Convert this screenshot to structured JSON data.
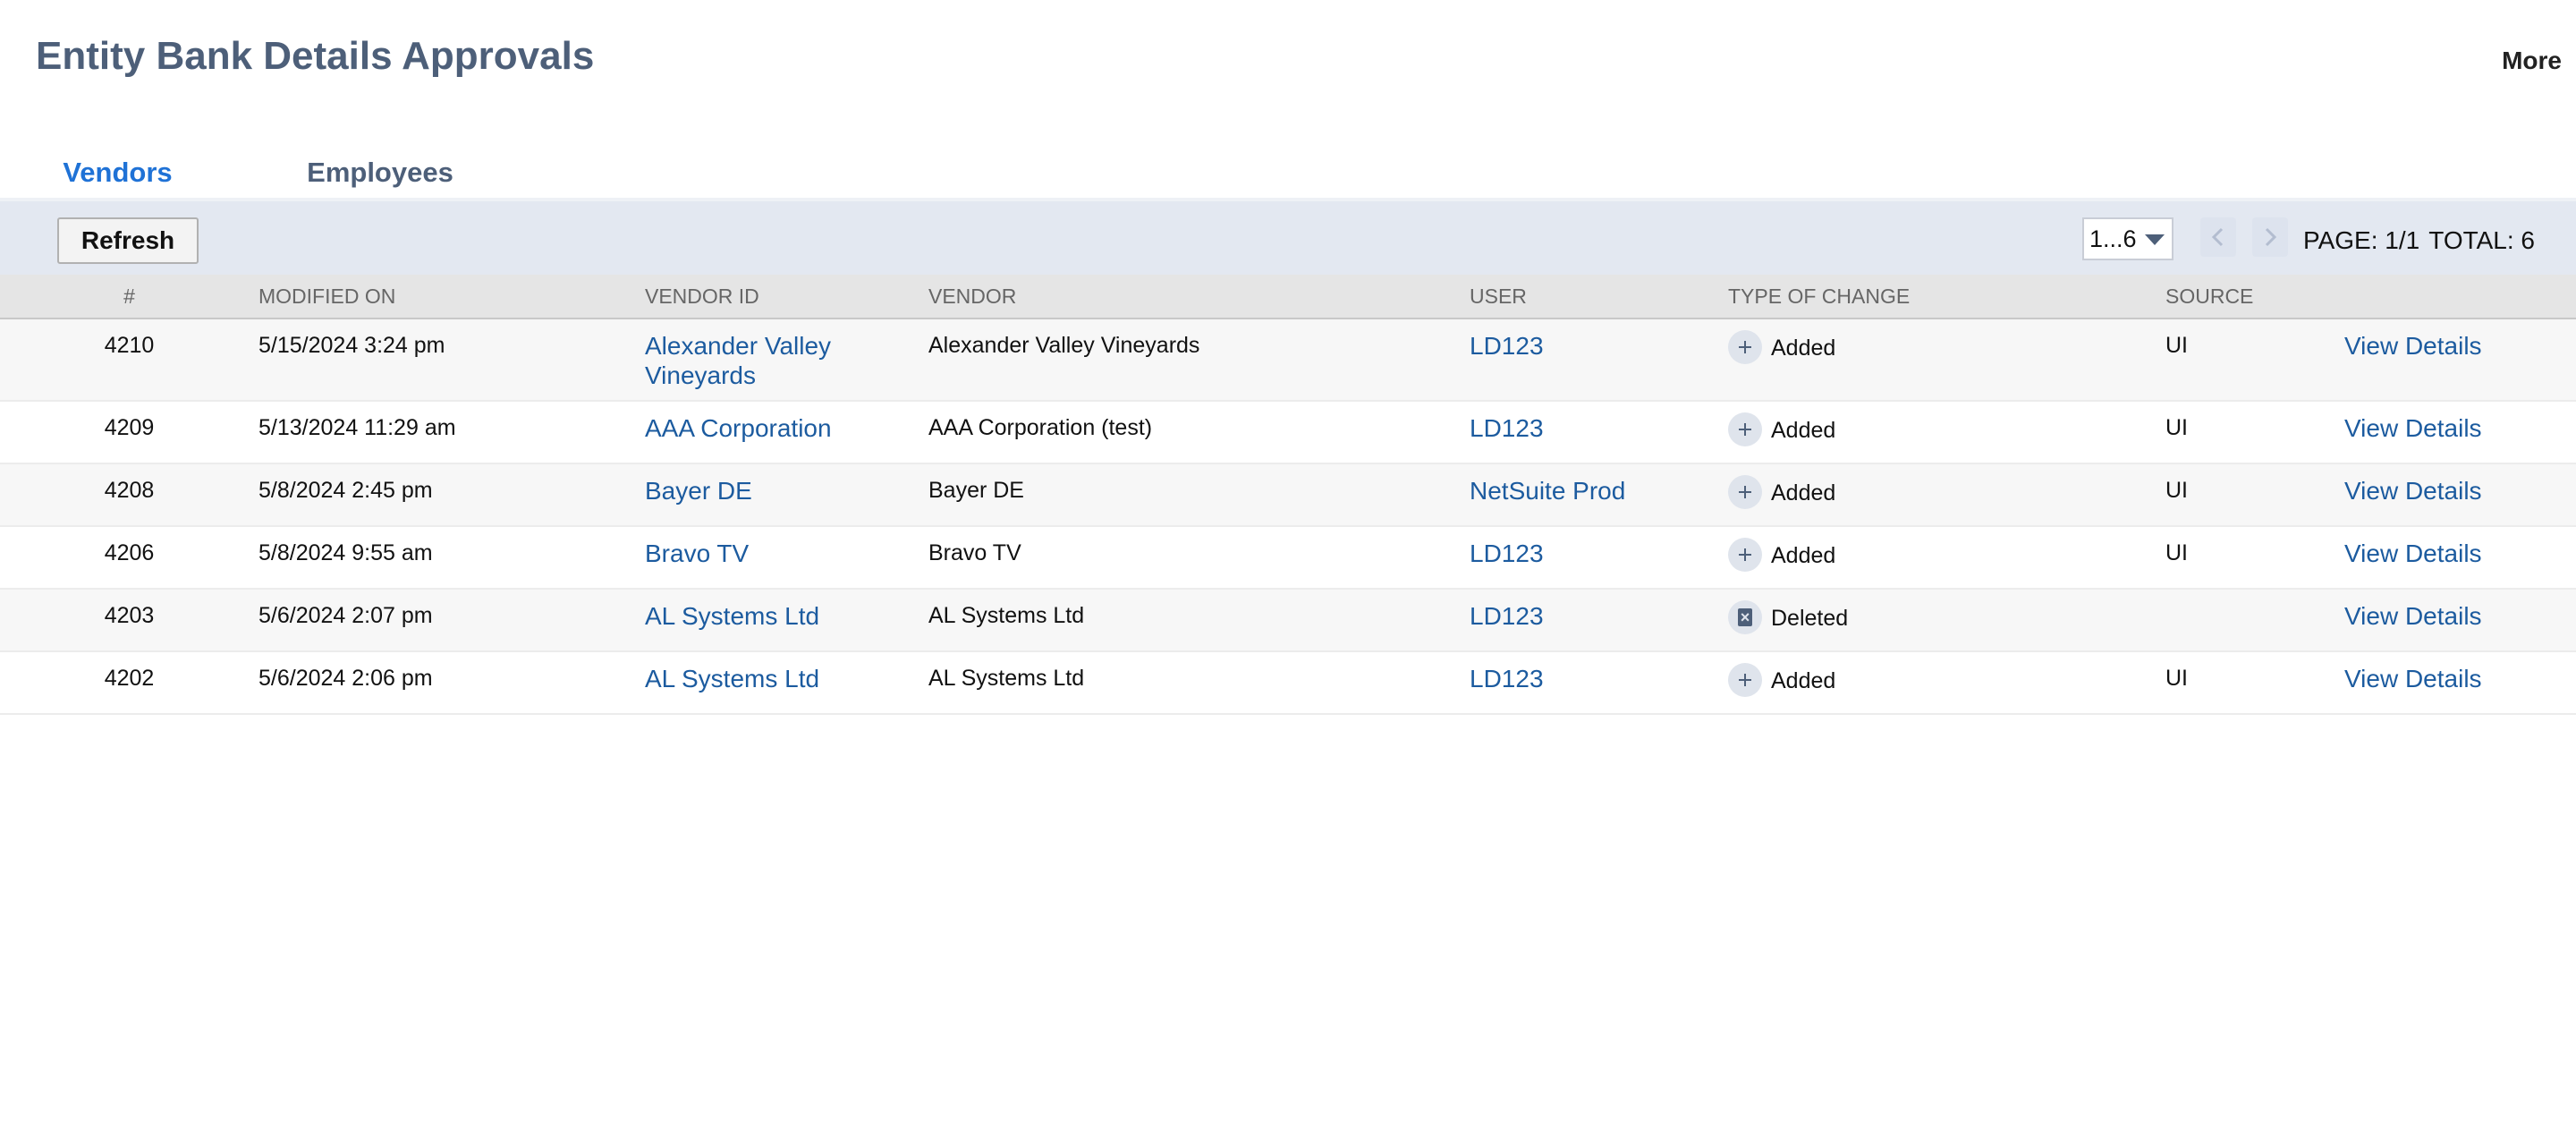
{
  "page": {
    "title": "Entity Bank Details Approvals",
    "more_label": "More"
  },
  "tabs": [
    {
      "label": "Vendors",
      "active": true
    },
    {
      "label": "Employees",
      "active": false
    }
  ],
  "toolbar": {
    "refresh_label": "Refresh",
    "range_select": "1...6",
    "page_label": "PAGE: 1/1",
    "total_label": "TOTAL: 6"
  },
  "table": {
    "columns": [
      "#",
      "MODIFIED ON",
      "VENDOR ID",
      "VENDOR",
      "USER",
      "TYPE OF CHANGE",
      "SOURCE",
      ""
    ],
    "rows": [
      {
        "num": "4210",
        "modified": "5/15/2024 3:24 pm",
        "vendor_id": "Alexander Valley Vineyards",
        "vendor": "Alexander Valley Vineyards",
        "user": "LD123",
        "change": "Added",
        "change_icon": "plus-icon",
        "source": "UI",
        "action": "View Details"
      },
      {
        "num": "4209",
        "modified": "5/13/2024 11:29 am",
        "vendor_id": "AAA Corporation",
        "vendor": "AAA Corporation (test)",
        "user": "LD123",
        "change": "Added",
        "change_icon": "plus-icon",
        "source": "UI",
        "action": "View Details"
      },
      {
        "num": "4208",
        "modified": "5/8/2024 2:45 pm",
        "vendor_id": "Bayer DE",
        "vendor": "Bayer DE",
        "user": "NetSuite Prod",
        "change": "Added",
        "change_icon": "plus-icon",
        "source": "UI",
        "action": "View Details"
      },
      {
        "num": "4206",
        "modified": "5/8/2024 9:55 am",
        "vendor_id": "Bravo TV",
        "vendor": "Bravo TV",
        "user": "LD123",
        "change": "Added",
        "change_icon": "plus-icon",
        "source": "UI",
        "action": "View Details"
      },
      {
        "num": "4203",
        "modified": "5/6/2024 2:07 pm",
        "vendor_id": "AL Systems Ltd",
        "vendor": "AL Systems Ltd",
        "user": "LD123",
        "change": "Deleted",
        "change_icon": "delete-icon",
        "source": "",
        "action": "View Details"
      },
      {
        "num": "4202",
        "modified": "5/6/2024 2:06 pm",
        "vendor_id": "AL Systems Ltd",
        "vendor": "AL Systems Ltd",
        "user": "LD123",
        "change": "Added",
        "change_icon": "plus-icon",
        "source": "UI",
        "action": "View Details"
      }
    ]
  }
}
